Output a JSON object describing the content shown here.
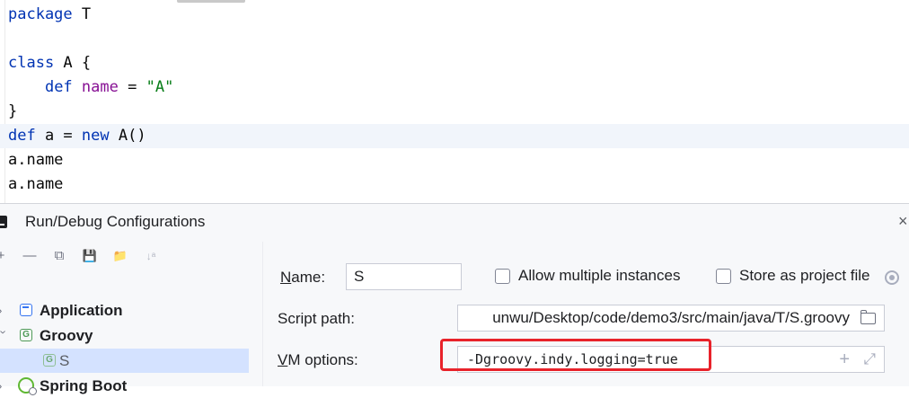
{
  "editor": {
    "lines": [
      [
        {
          "t": "package",
          "c": "kw"
        },
        {
          "t": " T",
          "c": ""
        }
      ],
      [],
      [
        {
          "t": "class",
          "c": "kw"
        },
        {
          "t": " A {",
          "c": ""
        }
      ],
      [
        {
          "t": "    ",
          "c": ""
        },
        {
          "t": "def",
          "c": "kw"
        },
        {
          "t": " ",
          "c": ""
        },
        {
          "t": "name",
          "c": "fn"
        },
        {
          "t": " = ",
          "c": ""
        },
        {
          "t": "\"A\"",
          "c": "str"
        }
      ],
      [
        {
          "t": "}",
          "c": ""
        }
      ],
      [
        {
          "t": "def",
          "c": "kw"
        },
        {
          "t": " a = ",
          "c": ""
        },
        {
          "t": "new",
          "c": "kw"
        },
        {
          "t": " A()",
          "c": ""
        }
      ],
      [
        {
          "t": "a.name",
          "c": ""
        }
      ],
      [
        {
          "t": "a.name",
          "c": ""
        }
      ]
    ],
    "current_line_index": 5
  },
  "dialog": {
    "title": "Run/Debug Configurations",
    "close_glyph": "×",
    "toolbar": {
      "add": "+",
      "remove": "—",
      "copy": "⧉",
      "save": "💾",
      "new_folder": "📁",
      "sort": "↓ᵃ"
    },
    "tree": {
      "application_label": "Application",
      "groovy_label": "Groovy",
      "s_label": "S",
      "spring_boot_label": "Spring Boot",
      "groovy_icon_letter": "G"
    },
    "form": {
      "name_label_mnemonic": "N",
      "name_label_rest": "ame:",
      "name_value": "S",
      "allow_multiple_label": "Allow multiple instances",
      "store_as_project_label": "Store as project file",
      "script_path_label": "Script path:",
      "script_path_value": "unwu/Desktop/code/demo3/src/main/java/T/S.groovy",
      "vm_options_label_mnemonic": "V",
      "vm_options_label_rest": "M options:",
      "vm_options_value": "-Dgroovy.indy.logging=true"
    }
  },
  "colors": {
    "keyword": "#0033b3",
    "member": "#871094",
    "string": "#067d17",
    "selection": "#d4e2ff",
    "highlight_box": "#e8222a"
  }
}
